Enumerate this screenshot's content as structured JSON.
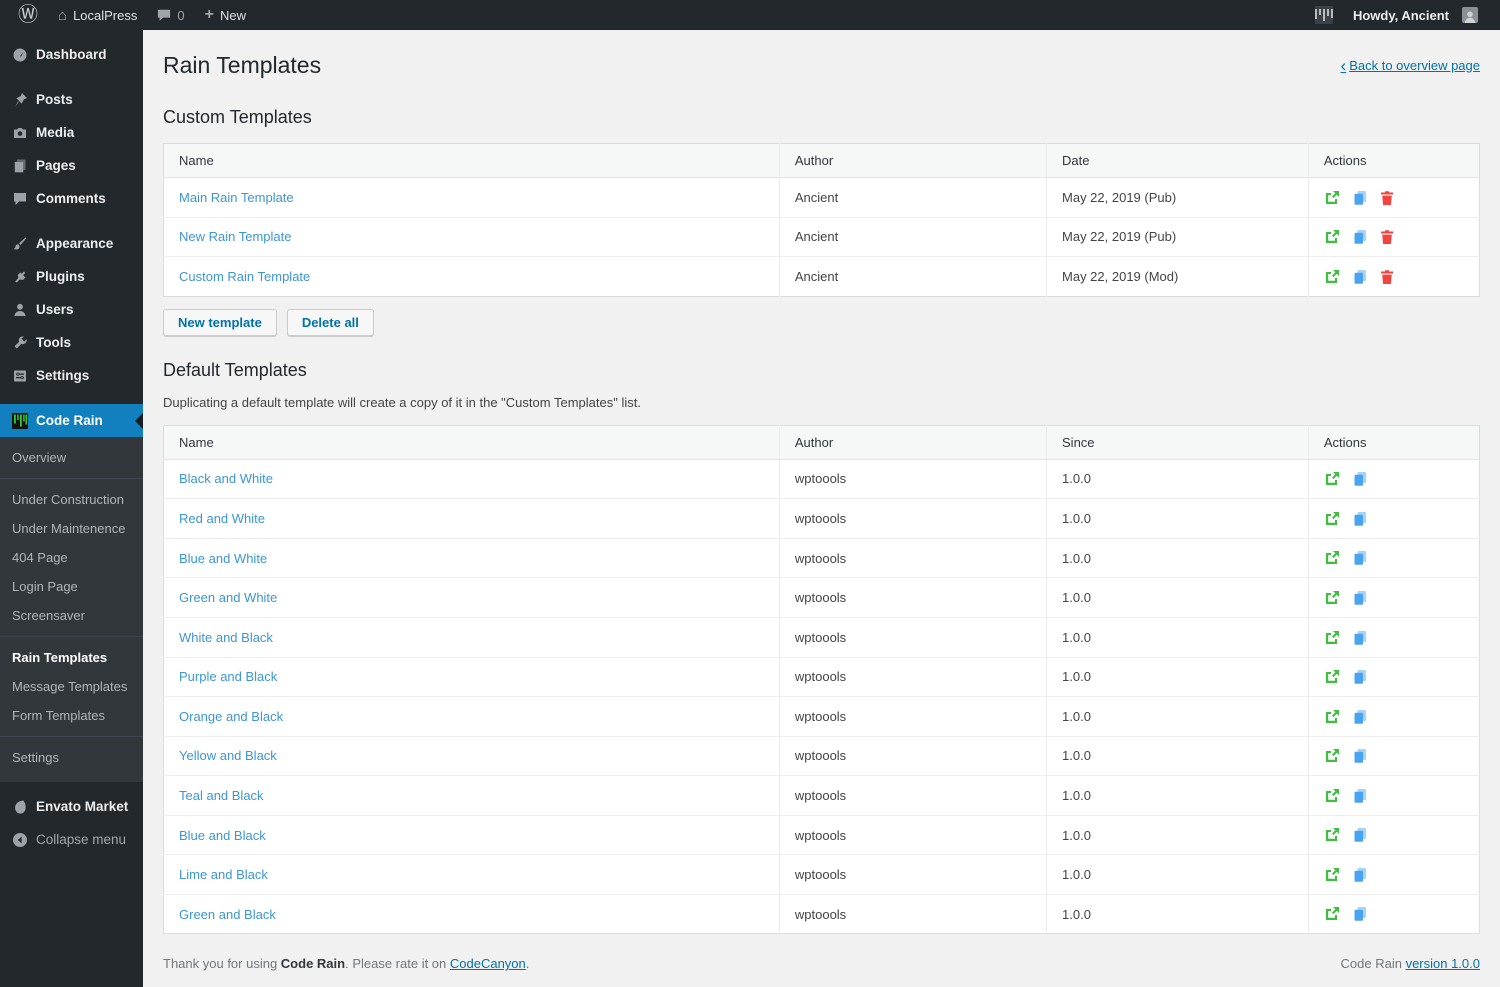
{
  "admin_bar": {
    "site_name": "LocalPress",
    "comments_count": "0",
    "new_label": "New",
    "howdy": "Howdy, Ancient"
  },
  "sidebar": {
    "items": [
      "Dashboard",
      "Posts",
      "Media",
      "Pages",
      "Comments",
      "Appearance",
      "Plugins",
      "Users",
      "Tools",
      "Settings"
    ],
    "code_rain": {
      "label": "Code Rain",
      "submenu": [
        "Overview",
        "Under Construction",
        "Under Maintenence",
        "404 Page",
        "Login Page",
        "Screensaver",
        "Rain Templates",
        "Message Templates",
        "Form Templates",
        "Settings"
      ],
      "active_item": "Rain Templates"
    },
    "envato_label": "Envato Market",
    "collapse_label": "Collapse menu"
  },
  "page": {
    "title": "Rain Templates",
    "back_link": "Back to overview page"
  },
  "custom_templates": {
    "heading": "Custom Templates",
    "columns": {
      "name": "Name",
      "author": "Author",
      "date": "Date",
      "actions": "Actions"
    },
    "rows": [
      {
        "name": "Main Rain Template",
        "author": "Ancient",
        "date": "May 22, 2019 (Pub)"
      },
      {
        "name": "New Rain Template",
        "author": "Ancient",
        "date": "May 22, 2019 (Pub)"
      },
      {
        "name": "Custom Rain Template",
        "author": "Ancient",
        "date": "May 22, 2019 (Mod)"
      }
    ],
    "buttons": {
      "new_template": "New template",
      "delete_all": "Delete all"
    }
  },
  "default_templates": {
    "heading": "Default Templates",
    "description": "Duplicating a default template will create a copy of it in the \"Custom Templates\" list.",
    "columns": {
      "name": "Name",
      "author": "Author",
      "since": "Since",
      "actions": "Actions"
    },
    "rows": [
      {
        "name": "Black and White",
        "author": "wptoools",
        "since": "1.0.0"
      },
      {
        "name": "Red and White",
        "author": "wptoools",
        "since": "1.0.0"
      },
      {
        "name": "Blue and White",
        "author": "wptoools",
        "since": "1.0.0"
      },
      {
        "name": "Green and White",
        "author": "wptoools",
        "since": "1.0.0"
      },
      {
        "name": "White and Black",
        "author": "wptoools",
        "since": "1.0.0"
      },
      {
        "name": "Purple and Black",
        "author": "wptoools",
        "since": "1.0.0"
      },
      {
        "name": "Orange and Black",
        "author": "wptoools",
        "since": "1.0.0"
      },
      {
        "name": "Yellow and Black",
        "author": "wptoools",
        "since": "1.0.0"
      },
      {
        "name": "Teal and Black",
        "author": "wptoools",
        "since": "1.0.0"
      },
      {
        "name": "Blue and Black",
        "author": "wptoools",
        "since": "1.0.0"
      },
      {
        "name": "Lime and Black",
        "author": "wptoools",
        "since": "1.0.0"
      },
      {
        "name": "Green and Black",
        "author": "wptoools",
        "since": "1.0.0"
      }
    ]
  },
  "footer": {
    "thanks_prefix": "Thank you for using ",
    "plugin_name": "Code Rain",
    "thanks_middle": ". Please rate it on ",
    "rate_link": "CodeCanyon",
    "thanks_suffix": ".",
    "version_prefix": "Code Rain ",
    "version_link": "version 1.0.0"
  },
  "colors": {
    "admin_bar_bg": "#23282d",
    "sidebar_bg": "#23282d",
    "submenu_bg": "#32373c",
    "active_menu_bg": "#1280be",
    "content_bg": "#f1f1f1",
    "link_blue": "#3d96d4",
    "button_blue": "#0073aa",
    "icon_green": "#3fbf3f",
    "icon_blue": "#4aa3f0",
    "icon_red": "#f24540"
  }
}
